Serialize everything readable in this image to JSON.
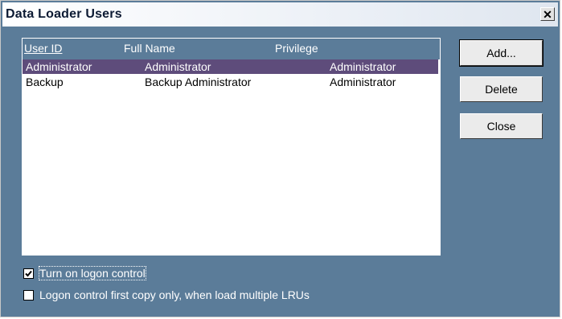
{
  "window": {
    "title": "Data Loader Users",
    "close_glyph": "✕"
  },
  "list": {
    "columns": [
      "User ID",
      "Full Name",
      "Privilege"
    ],
    "rows": [
      {
        "user_id": "Administrator",
        "full_name": "Administrator",
        "privilege": "Administrator",
        "selected": true
      },
      {
        "user_id": "Backup",
        "full_name": "Backup Administrator",
        "privilege": "Administrator",
        "selected": false
      }
    ]
  },
  "buttons": {
    "add": "Add...",
    "delete": "Delete",
    "close": "Close"
  },
  "options": {
    "logon_control": {
      "label": "Turn on logon control",
      "checked": true
    },
    "first_copy_only": {
      "label": "Logon control first copy only, when load multiple LRUs",
      "checked": false
    }
  },
  "colors": {
    "background": "#5b7c99",
    "selection": "#5e4c7b"
  }
}
